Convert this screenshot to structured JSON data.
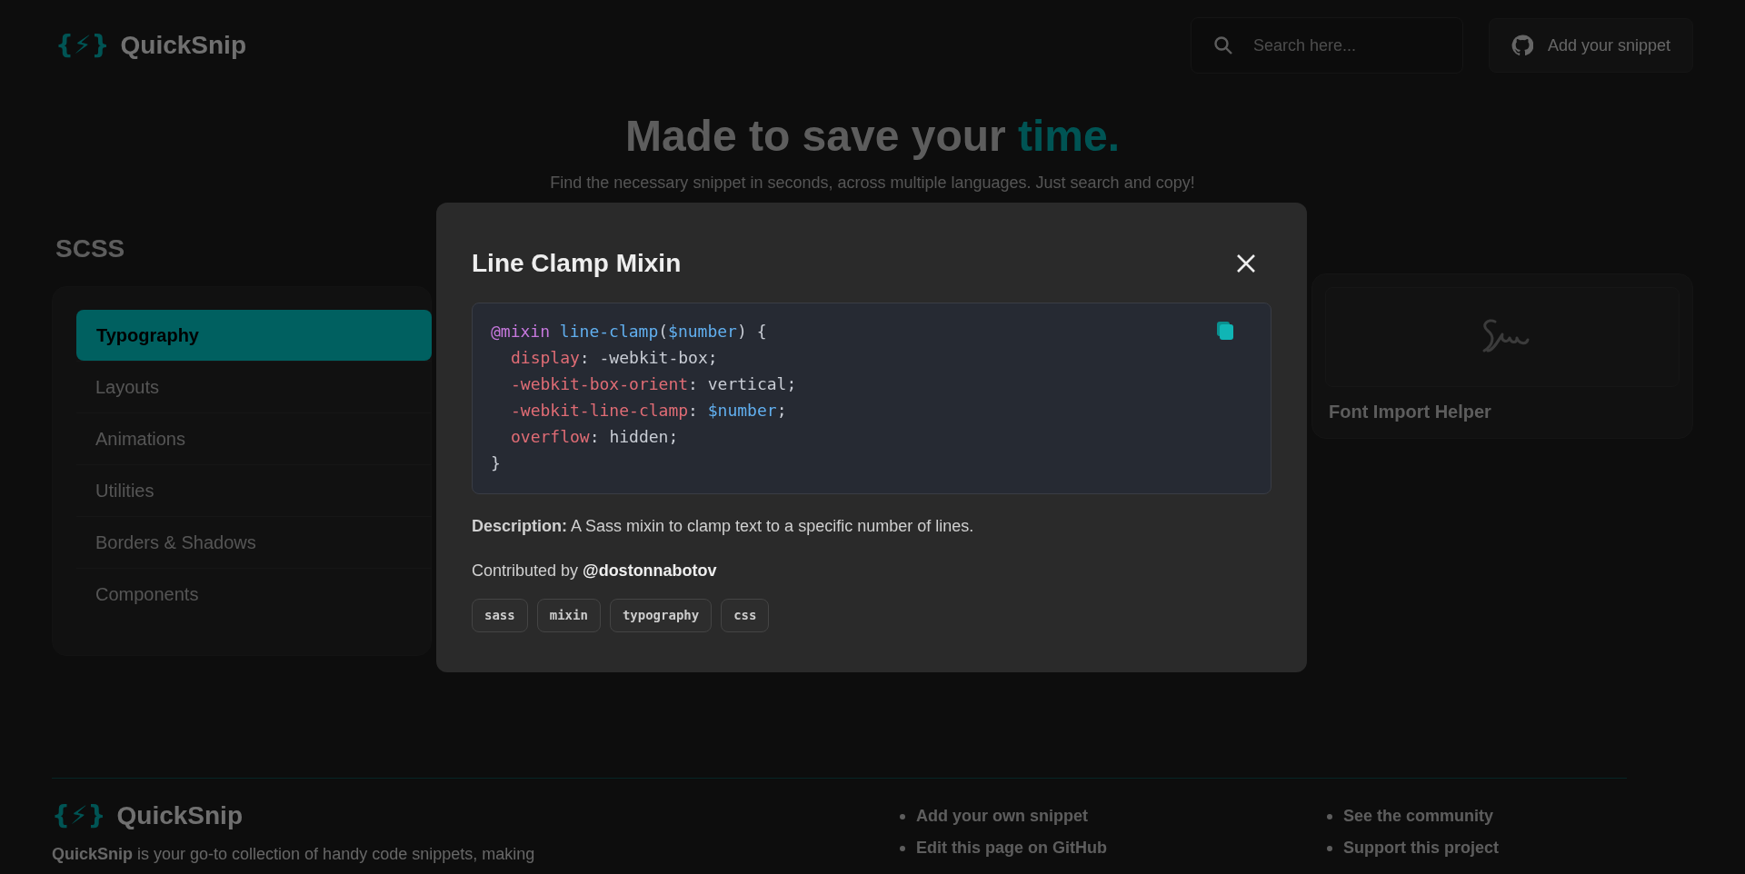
{
  "header": {
    "logo_mark": "{⚡}",
    "logo_text": "QuickSnip",
    "search": {
      "placeholder": "Search here..."
    },
    "add_button": "Add your snippet"
  },
  "hero": {
    "title": "Made to save your ",
    "title_accent": "time",
    "title_end": ".",
    "subtitle": "Find the necessary snippet in seconds, across multiple languages. Just search and copy!"
  },
  "language": "SCSS",
  "categories": [
    {
      "label": "Typography",
      "selected": true
    },
    {
      "label": "Layouts",
      "selected": false
    },
    {
      "label": "Animations",
      "selected": false
    },
    {
      "label": "Utilities",
      "selected": false
    },
    {
      "label": "Borders & Shadows",
      "selected": false
    },
    {
      "label": "Components",
      "selected": false
    }
  ],
  "snippet_cards": [
    {
      "title": "Font Import Helper"
    }
  ],
  "modal": {
    "title": "Line Clamp Mixin",
    "code": [
      {
        "indented": false,
        "tokens": [
          {
            "text": "@mixin",
            "kind": "keyword"
          },
          {
            "text": " line-clamp",
            "kind": "function"
          },
          {
            "text": "(",
            "kind": "plain"
          },
          {
            "text": "$number",
            "kind": "variable"
          },
          {
            "text": ") {",
            "kind": "plain"
          }
        ]
      },
      {
        "indented": true,
        "tokens": [
          {
            "text": "display",
            "kind": "property"
          },
          {
            "text": ": -webkit-box;",
            "kind": "plain"
          }
        ]
      },
      {
        "indented": true,
        "tokens": [
          {
            "text": "-webkit-box-orient",
            "kind": "property"
          },
          {
            "text": ": vertical;",
            "kind": "plain"
          }
        ]
      },
      {
        "indented": true,
        "tokens": [
          {
            "text": "-webkit-line-clamp",
            "kind": "property"
          },
          {
            "text": ": $number",
            "kind": "variable_after"
          },
          {
            "text": ";",
            "kind": "plain"
          }
        ]
      },
      {
        "indented": true,
        "tokens": [
          {
            "text": "overflow",
            "kind": "property"
          },
          {
            "text": ": hidden;",
            "kind": "plain"
          }
        ]
      },
      {
        "indented": false,
        "tokens": [
          {
            "text": "}",
            "kind": "plain"
          }
        ]
      }
    ],
    "description": "**Description:** A Sass mixin to clamp text to a specific number of lines.",
    "contributed_prefix": "Contributed by ",
    "author": "@dostonnabotov",
    "tags": [
      "sass",
      "mixin",
      "typography",
      "css"
    ]
  },
  "footer": {
    "logo_mark": "{⚡}",
    "logo_text": "QuickSnip",
    "about": "**QuickSnip** is your go-to collection of handy code snippets, making",
    "links_column_1": [
      "Add your own snippet",
      "Edit this page on GitHub"
    ],
    "links_column_2": [
      "See the community",
      "Support this project"
    ]
  }
}
